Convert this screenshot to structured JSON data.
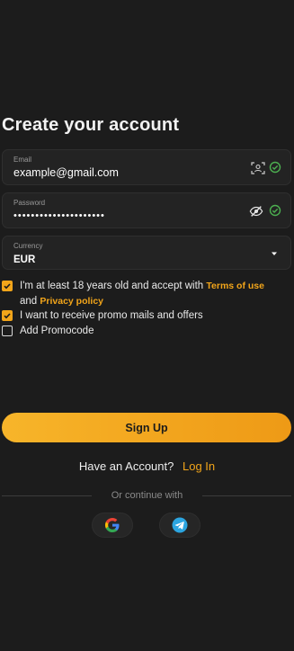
{
  "title": "Create your account",
  "email": {
    "label": "Email",
    "value": "example@gmail.com"
  },
  "password": {
    "label": "Password",
    "value": "•••••••••••••••••••••"
  },
  "currency": {
    "label": "Currency",
    "value": "EUR"
  },
  "checks": {
    "age_text": "I'm at least 18 years old and accept with",
    "terms_link": "Terms of use",
    "and_text": "and",
    "privacy_link": "Privacy policy",
    "promo_mails": "I want to receive promo mails and offers",
    "promocode": "Add Promocode",
    "age_checked": true,
    "promo_checked": true,
    "promocode_checked": false
  },
  "signup_label": "Sign Up",
  "account": {
    "question": "Have an Account?",
    "login": "Log In"
  },
  "continue_text": "Or continue with",
  "colors": {
    "accent": "#f2a51a",
    "background": "#1c1c1c",
    "valid": "#4caf50"
  },
  "icons": [
    "face-scan-icon",
    "check-circle-icon",
    "eye-off-icon",
    "caret-down-icon",
    "google-icon",
    "telegram-icon"
  ]
}
